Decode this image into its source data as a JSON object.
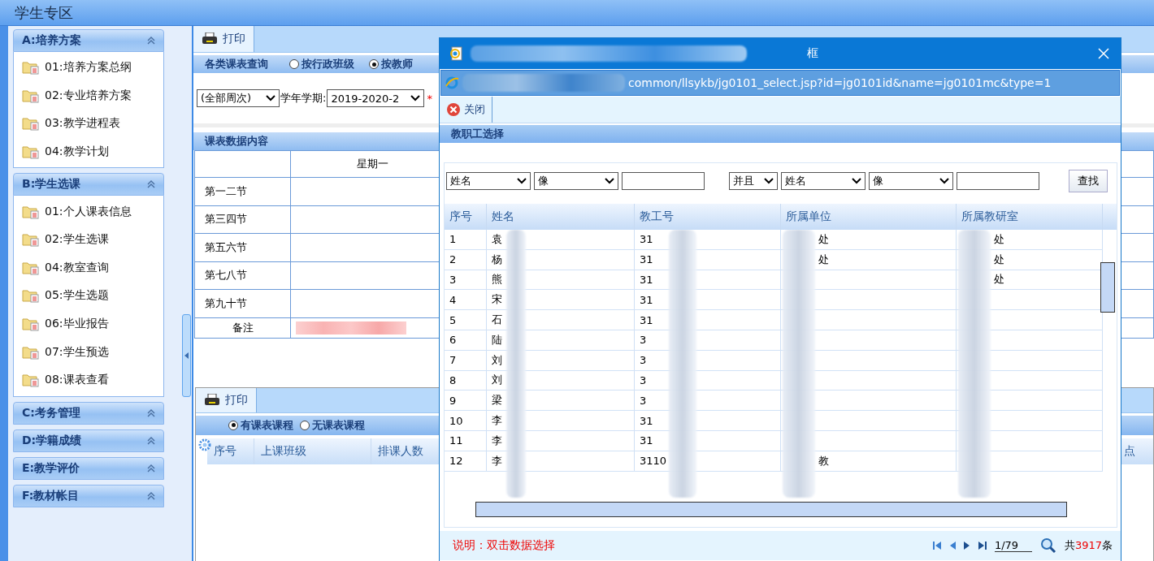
{
  "app_title": "学生专区",
  "sidebar": {
    "groups": [
      {
        "title": "A:培养方案",
        "expanded": true,
        "items": [
          "01:培养方案总纲",
          "02:专业培养方案",
          "03:教学进程表",
          "04:教学计划"
        ]
      },
      {
        "title": "B:学生选课",
        "expanded": true,
        "items": [
          "01:个人课表信息",
          "02:学生选课",
          "04:教室查询",
          "05:学生选题",
          "06:毕业报告",
          "07:学生预选",
          "08:课表查看"
        ]
      },
      {
        "title": "C:考务管理",
        "expanded": false
      },
      {
        "title": "D:学籍成绩",
        "expanded": false
      },
      {
        "title": "E:教学评价",
        "expanded": false
      },
      {
        "title": "F:教材帐目",
        "expanded": false
      }
    ]
  },
  "main": {
    "print": "打印",
    "query": {
      "title": "各类课表查询",
      "modes": [
        {
          "label": "按行政班级",
          "selected": false
        },
        {
          "label": "按教师",
          "selected": true
        }
      ],
      "week": "(全部周次)",
      "term_label": "学年学期:",
      "term": "2019-2020-2",
      "required_mark": "*"
    },
    "timetable": {
      "title": "课表数据内容",
      "columns": [
        "星期一"
      ],
      "rows": [
        "第一二节",
        "第三四节",
        "第五六节",
        "第七八节",
        "第九十节"
      ],
      "note_label": "备注"
    },
    "courses": {
      "print": "打印",
      "modes": [
        {
          "label": "有课表课程",
          "selected": true
        },
        {
          "label": "无课表课程",
          "selected": false
        }
      ],
      "columns": [
        "序号",
        "上课班级",
        "排课人数"
      ],
      "last_column": "点"
    }
  },
  "dialog": {
    "title": "框",
    "address": "common/llsykb/jg0101_select.jsp?id=jg0101id&name=jg0101mc&type=1",
    "close": "关闭",
    "section": "教职工选择",
    "filters": [
      {
        "kind": "select",
        "value": "姓名"
      },
      {
        "kind": "select",
        "value": "像"
      },
      {
        "kind": "input"
      },
      {
        "kind": "select",
        "value": "并且"
      },
      {
        "kind": "select",
        "value": "姓名"
      },
      {
        "kind": "select",
        "value": "像"
      },
      {
        "kind": "input"
      }
    ],
    "search": "查找",
    "columns": [
      "序号",
      "姓名",
      "教工号",
      "所属单位",
      "所属教研室"
    ],
    "rows": [
      {
        "index": "1",
        "name": "袁",
        "id": "31",
        "unit": "处",
        "office": "处"
      },
      {
        "index": "2",
        "name": "杨",
        "id": "31",
        "unit": "处",
        "office": "处"
      },
      {
        "index": "3",
        "name": "熊",
        "id": "31",
        "office": "处"
      },
      {
        "index": "4",
        "name": "宋",
        "id": "31"
      },
      {
        "index": "5",
        "name": "石",
        "id": "31"
      },
      {
        "index": "6",
        "name": "陆",
        "id": "3"
      },
      {
        "index": "7",
        "name": "刘",
        "id": "3"
      },
      {
        "index": "8",
        "name": "刘",
        "id": "3"
      },
      {
        "index": "9",
        "name": "梁",
        "id": "3"
      },
      {
        "index": "10",
        "name": "李",
        "id": "31"
      },
      {
        "index": "11",
        "name": "李",
        "id": "31"
      },
      {
        "index": "12",
        "name": "李",
        "id": "3110",
        "unit": "教"
      }
    ],
    "footer": {
      "hint": "说明：双击数据选择",
      "page": "1/79",
      "total_prefix": "共",
      "total": "3917",
      "total_suffix": "条"
    }
  }
}
